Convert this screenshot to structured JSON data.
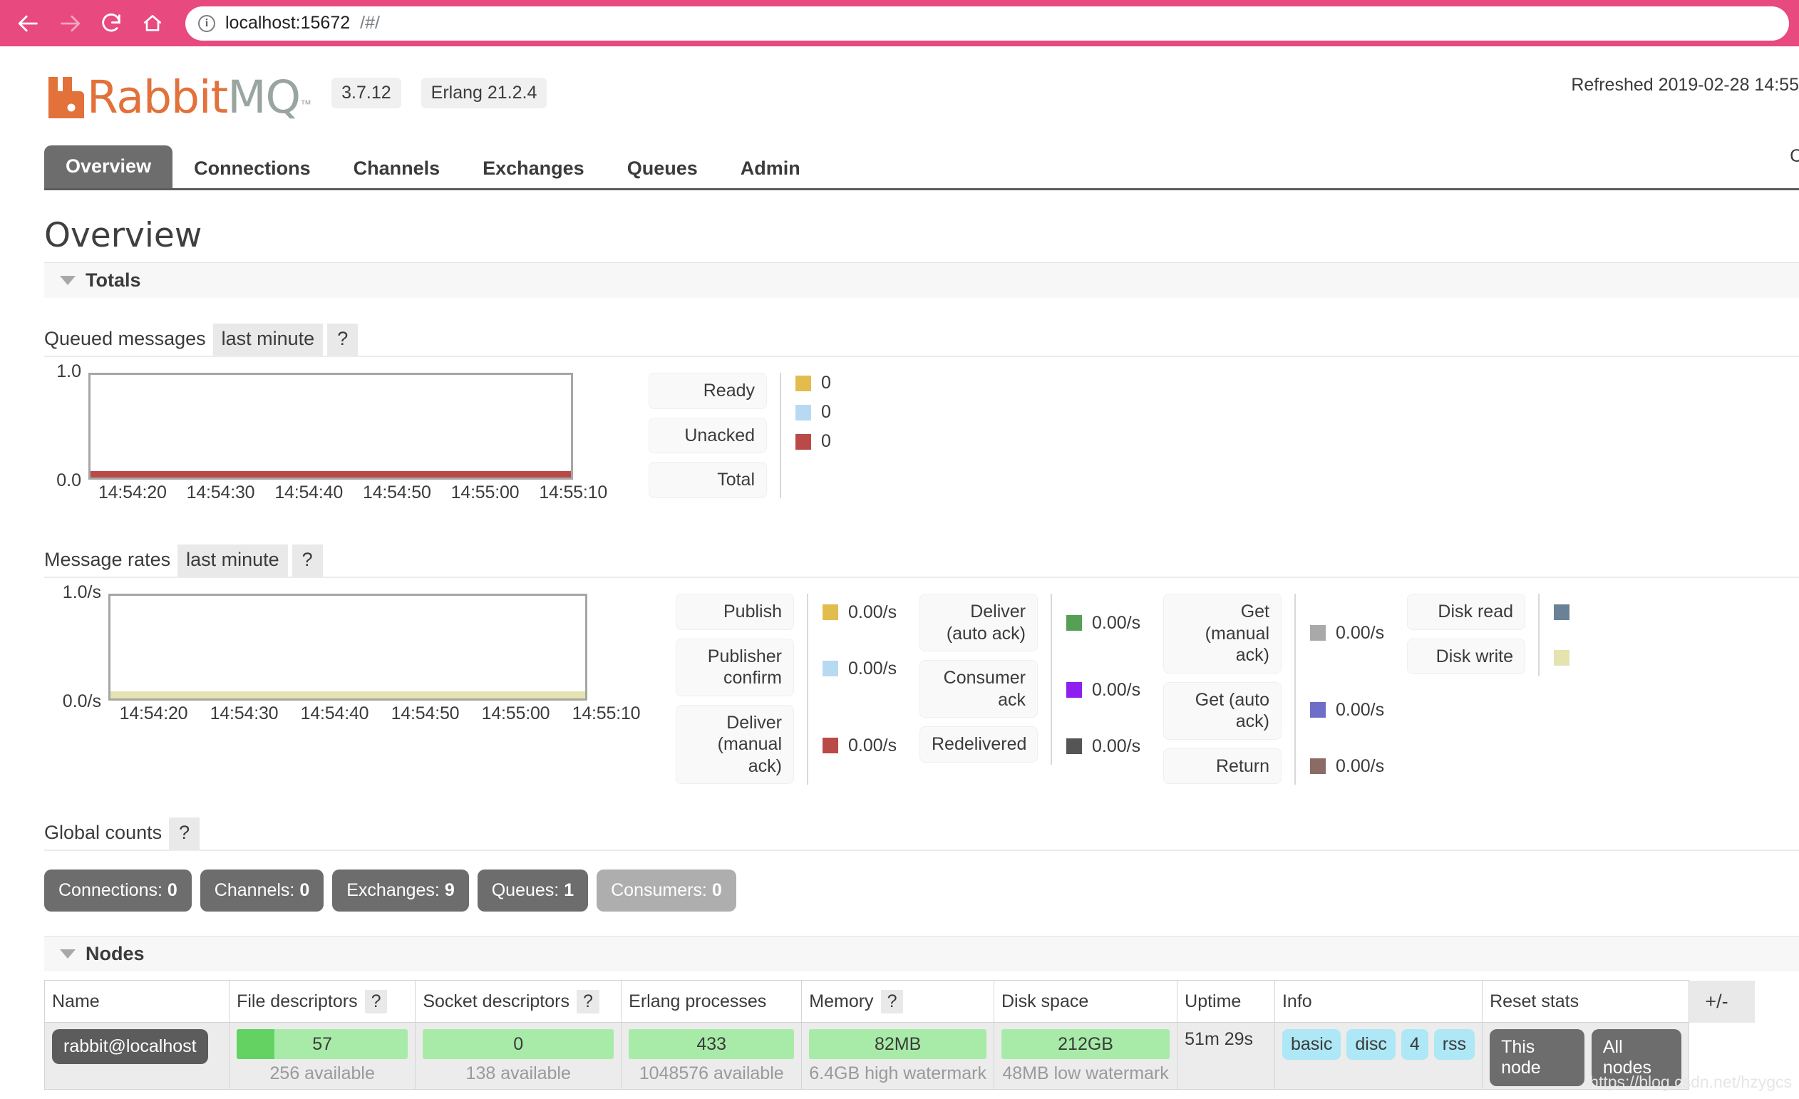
{
  "browser": {
    "back_icon": "arrow-left-icon",
    "forward_icon": "arrow-right-icon",
    "reload_icon": "reload-icon",
    "home_icon": "home-icon",
    "url_host": "localhost:15672",
    "url_path": "/#/",
    "chrome_color": "#e8497e"
  },
  "header": {
    "logo_rabbit": "Rabbit",
    "logo_mq": "MQ",
    "logo_tm": "™",
    "version_badge": "3.7.12",
    "erlang_badge": "Erlang 21.2.4",
    "refreshed": "Refreshed 2019-02-28 14:55",
    "cluster": "Cluste"
  },
  "tabs": [
    {
      "label": "Overview",
      "active": true
    },
    {
      "label": "Connections",
      "active": false
    },
    {
      "label": "Channels",
      "active": false
    },
    {
      "label": "Exchanges",
      "active": false
    },
    {
      "label": "Queues",
      "active": false
    },
    {
      "label": "Admin",
      "active": false
    }
  ],
  "page_title": "Overview",
  "sections": {
    "totals": "Totals",
    "nodes": "Nodes"
  },
  "queued_messages": {
    "label": "Queued messages",
    "period_chip": "last minute",
    "help_chip": "?",
    "legend": [
      {
        "button": "Ready",
        "value": "0",
        "color": "#e3bc4e"
      },
      {
        "button": "Unacked",
        "value": "0",
        "color": "#b8d9f2"
      },
      {
        "button": "Total",
        "value": "0",
        "color": "#b94a48"
      }
    ]
  },
  "message_rates": {
    "label": "Message rates",
    "period_chip": "last minute",
    "help_chip": "?",
    "group1": [
      {
        "button": "Publish",
        "value": "0.00/s",
        "color": "#e3bc4e"
      },
      {
        "button": "Publisher\nconfirm",
        "value": "0.00/s",
        "color": "#b8d9f2"
      },
      {
        "button": "Deliver\n(manual\nack)",
        "value": "0.00/s",
        "color": "#b94a48"
      }
    ],
    "group2": [
      {
        "button": "Deliver\n(auto ack)",
        "value": "0.00/s",
        "color": "#55a055"
      },
      {
        "button": "Consumer\nack",
        "value": "0.00/s",
        "color": "#8f1ef0"
      },
      {
        "button": "Redelivered",
        "value": "0.00/s",
        "color": "#555555"
      }
    ],
    "group3": [
      {
        "button": "Get\n(manual\nack)",
        "value": "0.00/s",
        "color": "#a9a9a9"
      },
      {
        "button": "Get (auto\nack)",
        "value": "0.00/s",
        "color": "#6e6ec8"
      },
      {
        "button": "Return",
        "value": "0.00/s",
        "color": "#8c6a66"
      }
    ],
    "group4": [
      {
        "button": "Disk read",
        "value": "",
        "color": "#6b8296"
      },
      {
        "button": "Disk write",
        "value": "",
        "color": "#e5e3b0"
      }
    ]
  },
  "chart_data": [
    {
      "type": "area",
      "title": "Queued messages",
      "xlabel": "",
      "ylabel": "",
      "ylim": [
        0.0,
        1.0
      ],
      "ytick_labels": [
        "1.0",
        "0.0"
      ],
      "x": [
        "14:54:20",
        "14:54:30",
        "14:54:40",
        "14:54:50",
        "14:55:00",
        "14:55:10"
      ],
      "grid": false,
      "legend_position": "right",
      "series": [
        {
          "name": "Ready",
          "color": "#e3bc4e",
          "values": [
            0,
            0,
            0,
            0,
            0,
            0
          ]
        },
        {
          "name": "Unacked",
          "color": "#b8d9f2",
          "values": [
            0,
            0,
            0,
            0,
            0,
            0
          ]
        },
        {
          "name": "Total",
          "color": "#b94a48",
          "values": [
            0,
            0,
            0,
            0,
            0,
            0
          ]
        }
      ]
    },
    {
      "type": "area",
      "title": "Message rates",
      "xlabel": "",
      "ylabel": "",
      "ylim": [
        0.0,
        1.0
      ],
      "ytick_labels": [
        "1.0/s",
        "0.0/s"
      ],
      "x": [
        "14:54:20",
        "14:54:30",
        "14:54:40",
        "14:54:50",
        "14:55:00",
        "14:55:10"
      ],
      "grid": false,
      "legend_position": "right",
      "series": [
        {
          "name": "Publish",
          "color": "#e3bc4e",
          "values": [
            0,
            0,
            0,
            0,
            0,
            0
          ]
        },
        {
          "name": "Publisher confirm",
          "color": "#b8d9f2",
          "values": [
            0,
            0,
            0,
            0,
            0,
            0
          ]
        },
        {
          "name": "Deliver (manual ack)",
          "color": "#b94a48",
          "values": [
            0,
            0,
            0,
            0,
            0,
            0
          ]
        },
        {
          "name": "Deliver (auto ack)",
          "color": "#55a055",
          "values": [
            0,
            0,
            0,
            0,
            0,
            0
          ]
        },
        {
          "name": "Consumer ack",
          "color": "#8f1ef0",
          "values": [
            0,
            0,
            0,
            0,
            0,
            0
          ]
        },
        {
          "name": "Redelivered",
          "color": "#555555",
          "values": [
            0,
            0,
            0,
            0,
            0,
            0
          ]
        },
        {
          "name": "Get (manual ack)",
          "color": "#a9a9a9",
          "values": [
            0,
            0,
            0,
            0,
            0,
            0
          ]
        },
        {
          "name": "Get (auto ack)",
          "color": "#6e6ec8",
          "values": [
            0,
            0,
            0,
            0,
            0,
            0
          ]
        },
        {
          "name": "Return",
          "color": "#8c6a66",
          "values": [
            0,
            0,
            0,
            0,
            0,
            0
          ]
        },
        {
          "name": "Disk read",
          "color": "#6b8296",
          "values": [
            0,
            0,
            0,
            0,
            0,
            0
          ]
        },
        {
          "name": "Disk write",
          "color": "#e5e3b0",
          "values": [
            0,
            0,
            0,
            0,
            0,
            0
          ]
        }
      ]
    }
  ],
  "global_counts": {
    "label": "Global counts",
    "help_chip": "?",
    "items": [
      {
        "label": "Connections:",
        "value": "0",
        "muted": false
      },
      {
        "label": "Channels:",
        "value": "0",
        "muted": false
      },
      {
        "label": "Exchanges:",
        "value": "9",
        "muted": false
      },
      {
        "label": "Queues:",
        "value": "1",
        "muted": false
      },
      {
        "label": "Consumers:",
        "value": "0",
        "muted": true
      }
    ]
  },
  "nodes_table": {
    "columns": [
      {
        "label": "Name",
        "help": false
      },
      {
        "label": "File descriptors",
        "help": true
      },
      {
        "label": "Socket descriptors",
        "help": true
      },
      {
        "label": "Erlang processes",
        "help": false
      },
      {
        "label": "Memory",
        "help": true
      },
      {
        "label": "Disk space",
        "help": false
      },
      {
        "label": "Uptime",
        "help": false
      },
      {
        "label": "Info",
        "help": false
      },
      {
        "label": "Reset stats",
        "help": false
      }
    ],
    "plusminus": "+/-",
    "row": {
      "name": "rabbit@localhost",
      "file_descriptors": {
        "value": "57",
        "sub": "256 available",
        "fill_pct": 22
      },
      "socket_descriptors": {
        "value": "0",
        "sub": "138 available",
        "fill_pct": 0
      },
      "erlang_processes": {
        "value": "433",
        "sub": "1048576 available",
        "fill_pct": 0
      },
      "memory": {
        "value": "82MB",
        "sub": "6.4GB high watermark",
        "fill_pct": 0
      },
      "disk_space": {
        "value": "212GB",
        "sub": "48MB low watermark",
        "fill_pct": 0
      },
      "uptime": "51m 29s",
      "info_badges": [
        "basic",
        "disc",
        "4",
        "rss"
      ],
      "reset_buttons": [
        "This node",
        "All nodes"
      ]
    }
  },
  "watermark": "https://blog.csdn.net/hzygcs"
}
